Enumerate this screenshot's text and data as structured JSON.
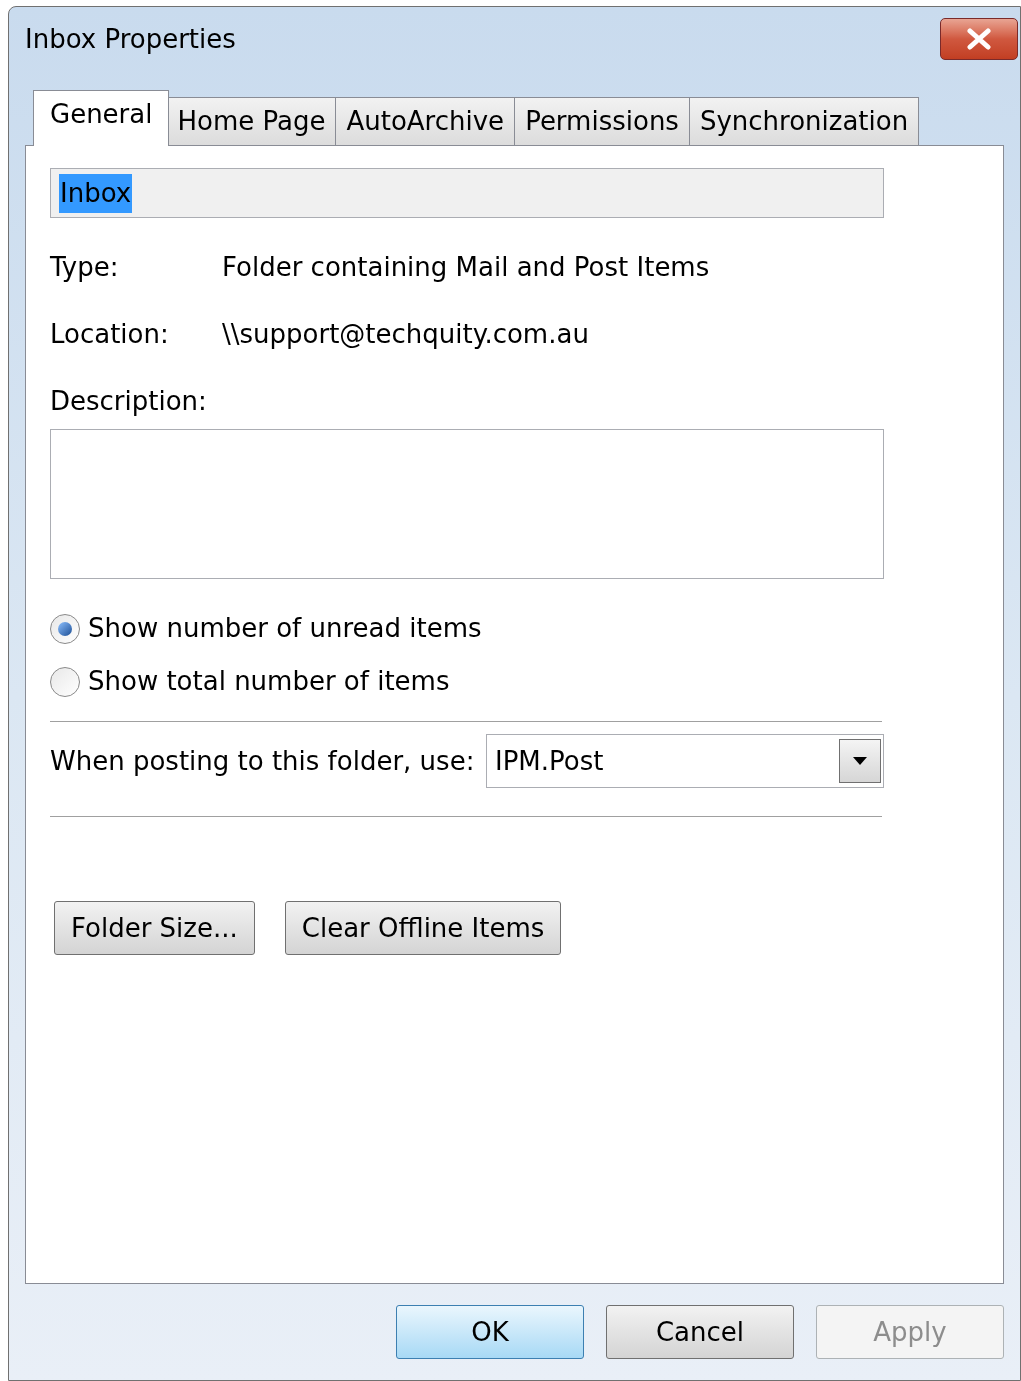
{
  "window": {
    "title": "Inbox Properties"
  },
  "tabs": [
    {
      "label": "General",
      "selected": true
    },
    {
      "label": "Home Page",
      "selected": false
    },
    {
      "label": "AutoArchive",
      "selected": false
    },
    {
      "label": "Permissions",
      "selected": false
    },
    {
      "label": "Synchronization",
      "selected": false
    }
  ],
  "name_field": {
    "value": "Inbox",
    "text_selected": true
  },
  "properties": [
    {
      "label": "Type:",
      "value": "Folder containing Mail and Post Items"
    },
    {
      "label": "Location:",
      "value": "\\\\support@techquity.com.au"
    }
  ],
  "description": {
    "label": "Description:"
  },
  "count_options": [
    {
      "label": "Show number of unread items",
      "selected": true
    },
    {
      "label": "Show total number of items",
      "selected": false
    }
  ],
  "posting": {
    "label": "When posting to this folder, use:",
    "value": "IPM.Post"
  },
  "actions": [
    {
      "label": "Folder Size..."
    },
    {
      "label": "Clear Offline Items"
    }
  ],
  "buttons": [
    {
      "label": "OK",
      "default": true,
      "disabled": false
    },
    {
      "label": "Cancel",
      "default": false,
      "disabled": false
    },
    {
      "label": "Apply",
      "default": false,
      "disabled": true
    }
  ]
}
